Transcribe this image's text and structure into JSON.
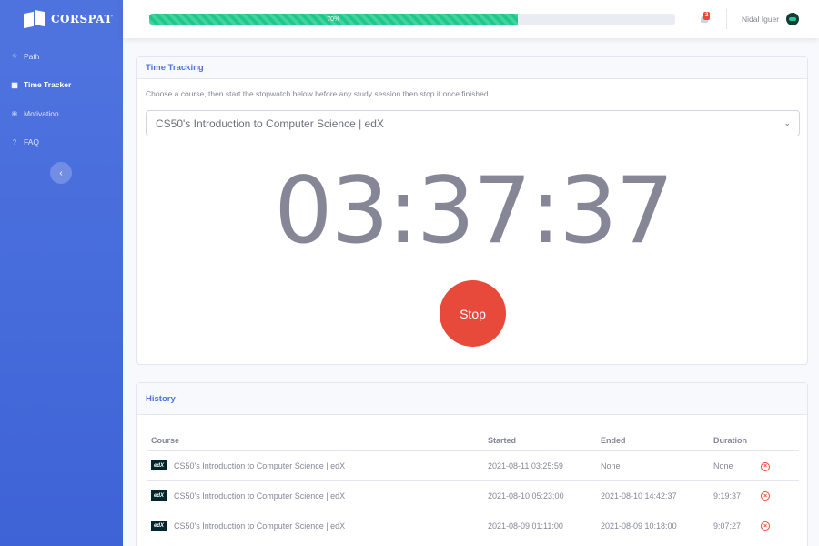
{
  "app": {
    "brand": "CORSPAT"
  },
  "sidebar": {
    "items": [
      {
        "label": "Path",
        "icon": "route-icon",
        "glyph": "⛗"
      },
      {
        "label": "Time Tracker",
        "icon": "table-icon",
        "glyph": "▦"
      },
      {
        "label": "Motivation",
        "icon": "broadcast-icon",
        "glyph": "◉"
      },
      {
        "label": "FAQ",
        "icon": "question-icon",
        "glyph": "?"
      }
    ],
    "collapse_glyph": "‹"
  },
  "topbar": {
    "progress_label": "70%",
    "progress_fraction": 0.7,
    "notification_count": "2",
    "user_name": "Nidal Iguer"
  },
  "time_tracking": {
    "header": "Time Tracking",
    "description": "Choose a course, then start the stopwatch below before any study session then stop it once finished.",
    "selected_course": "CS50's Introduction to Computer Science | edX",
    "timer": "03:37:37",
    "stop_label": "Stop"
  },
  "history": {
    "header": "History",
    "columns": [
      "Course",
      "Started",
      "Ended",
      "Duration"
    ],
    "provider_logo": "edX",
    "rows": [
      {
        "course": "CS50's Introduction to Computer Science | edX",
        "started": "2021-08-11 03:25:59",
        "ended": "None",
        "duration": "None"
      },
      {
        "course": "CS50's Introduction to Computer Science | edX",
        "started": "2021-08-10 05:23:00",
        "ended": "2021-08-10 14:42:37",
        "duration": "9:19:37"
      },
      {
        "course": "CS50's Introduction to Computer Science | edX",
        "started": "2021-08-09 01:11:00",
        "ended": "2021-08-09 10:18:00",
        "duration": "9:07:27"
      }
    ]
  },
  "colors": {
    "primary": "#4e73df",
    "success": "#1cc88a",
    "danger": "#e74a3b"
  }
}
